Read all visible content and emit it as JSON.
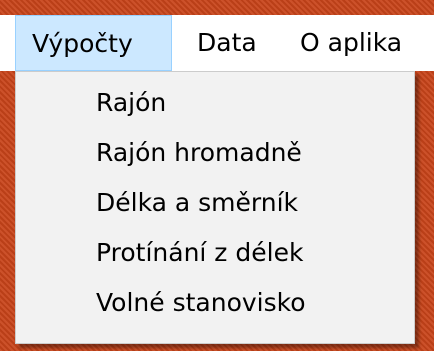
{
  "menubar": {
    "items": [
      {
        "label": "Výpočty"
      },
      {
        "label": "Data"
      },
      {
        "label": "O aplika"
      }
    ]
  },
  "dropdown": {
    "items": [
      {
        "label": "Rajón"
      },
      {
        "label": "Rajón hromadně"
      },
      {
        "label": "Délka a směrník"
      },
      {
        "label": "Protínání z délek"
      },
      {
        "label": "Volné stanovisko"
      }
    ]
  }
}
